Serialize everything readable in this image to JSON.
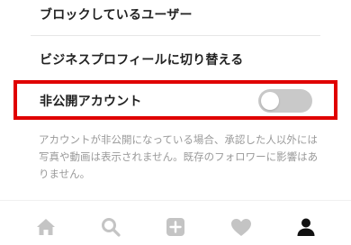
{
  "settings": {
    "blocked_users_label": "ブロックしているユーザー",
    "switch_business_label": "ビジネスプロフィールに切り替える",
    "private_account": {
      "label": "非公開アカウント",
      "enabled": false
    },
    "private_account_description": "アカウントが非公開になっている場合、承認した人以外には写真や動画は表示されません。既存のフォロワーに影響はありません。"
  },
  "tab_bar": {
    "icons": [
      "home-icon",
      "search-icon",
      "add-post-icon",
      "heart-icon",
      "profile-icon"
    ],
    "active_tab": "profile"
  },
  "colors": {
    "highlight_border": "#e00000",
    "toggle_off": "#c9c9c9",
    "text_primary": "#222222",
    "text_secondary": "#9a9a9a",
    "tab_inactive": "#c4c4c4",
    "tab_active": "#111111"
  }
}
